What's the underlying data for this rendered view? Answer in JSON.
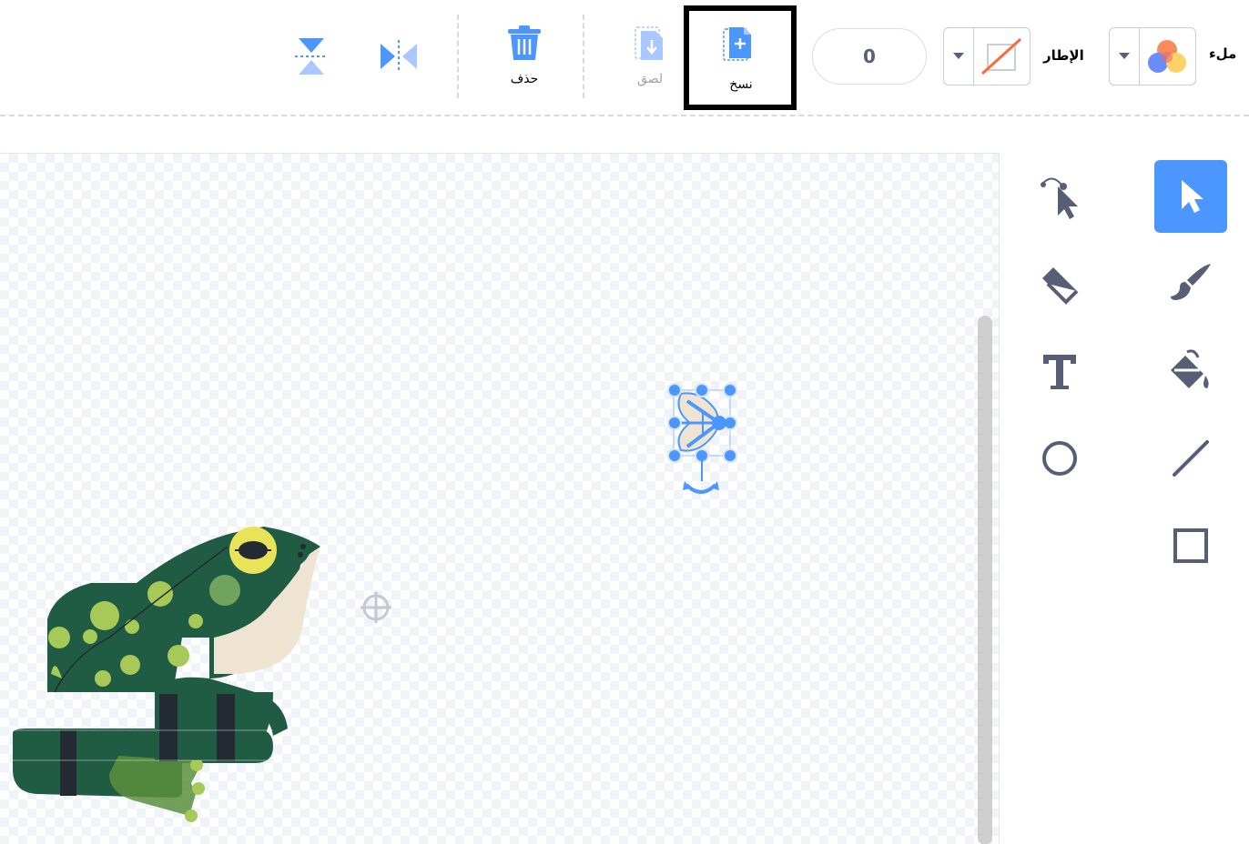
{
  "toolbar": {
    "fill_label": "ملء",
    "outline_label": "الإطار",
    "outline_width_value": "0",
    "copy_label": "نسخ",
    "paste_label": "لصق",
    "delete_label": "حذف"
  },
  "icons": {
    "fill_swatch": "fill-color-swatch-icon",
    "outline_swatch": "no-outline-swatch-icon",
    "copy": "copy-icon",
    "paste": "paste-icon",
    "delete": "trash-icon",
    "flip_h": "flip-horizontal-icon",
    "flip_v": "flip-vertical-icon",
    "select": "select-arrow-icon",
    "reshape": "reshape-icon",
    "brush": "brush-icon",
    "eraser": "eraser-icon",
    "fill": "fill-bucket-icon",
    "text": "text-icon",
    "line": "line-icon",
    "circle": "circle-icon",
    "rectangle": "rectangle-icon"
  },
  "colors": {
    "accent": "#4c97ff",
    "highlight_border": "#000000",
    "selection": "#4c97ff"
  }
}
